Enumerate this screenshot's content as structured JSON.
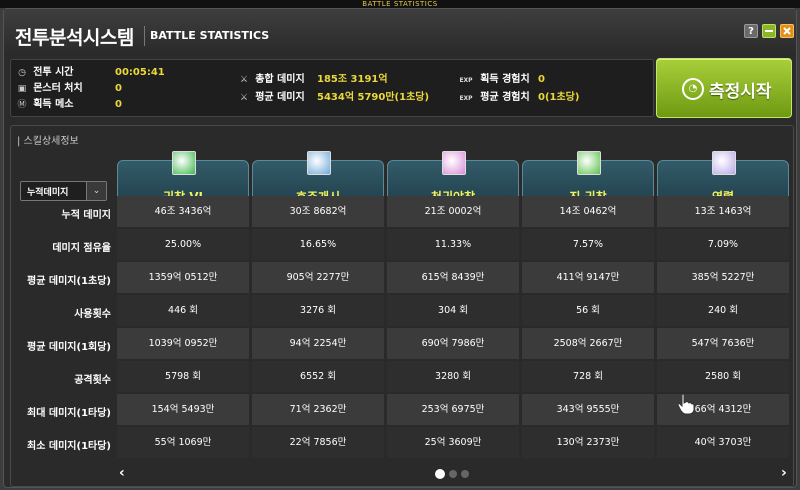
{
  "top_strip": "BATTLE STATISTICS",
  "window": {
    "title_ko": "전투분석시스템",
    "title_en": "BATTLE STATISTICS",
    "help_label": "?",
    "colors": {
      "accent_green": "#8bb52a",
      "close_orange": "#e2901a",
      "value_yellow": "#e9d93a",
      "header_teal": "#2b4f5c"
    }
  },
  "stats": {
    "battle_time": {
      "label": "전투 시간",
      "value": "00:05:41",
      "icon": "clock-icon"
    },
    "monsters": {
      "label": "몬스터 처치",
      "value": "0",
      "icon": "monster-icon"
    },
    "meso": {
      "label": "획득 메소",
      "value": "0",
      "icon": "meso-icon"
    },
    "total_damage": {
      "label": "총합 데미지",
      "value": "185조 3191억",
      "icon": "sword-icon"
    },
    "avg_damage": {
      "label": "평균 데미지",
      "value": "5434억 5790만(1초당)",
      "icon": "sword-icon"
    },
    "exp_gain": {
      "label": "획득 경험치",
      "value": "0",
      "icon_text": "EXP"
    },
    "avg_exp": {
      "label": "평균 경험치",
      "value": "0(1초당)",
      "icon_text": "EXP"
    }
  },
  "measure_button": {
    "label": "측정시작",
    "icon": "gauge-icon"
  },
  "detail": {
    "title": "| 스킬상세정보",
    "sort": {
      "selected": "누적데미지",
      "arrow": "⌄"
    },
    "row_labels": [
      "누적 데미지",
      "데미지 점유율",
      "평균 데미지(1초당)",
      "사용횟수",
      "평균 데미지(1회당)",
      "공격횟수",
      "최대 데미지(1타당)",
      "최소 데미지(1타당)"
    ],
    "skills": [
      {
        "name": "귀참 VI",
        "icon_color": "#3cb84a",
        "values": [
          "46조 3436억",
          "25.00%",
          "1359억 0512만",
          "446 회",
          "1039억 0952만",
          "5798 회",
          "154억 5493만",
          "55억 1069만"
        ]
      },
      {
        "name": "호주개시",
        "icon_color": "#6fa8d8",
        "values": [
          "30조 8682억",
          "16.65%",
          "905억 2277만",
          "3276 회",
          "94억 2254만",
          "6552 회",
          "71억 2362만",
          "22억 7856만"
        ]
      },
      {
        "name": "천귀야참",
        "icon_color": "#d98ad8",
        "values": [
          "21조 0002억",
          "11.33%",
          "615억 8439만",
          "304 회",
          "690억 7986만",
          "3280 회",
          "253억 6975만",
          "25억 3609만"
        ]
      },
      {
        "name": "진 귀참",
        "icon_color": "#5cc04a",
        "values": [
          "14조 0462억",
          "7.57%",
          "411억 9147만",
          "56 회",
          "2508억 2667만",
          "728 회",
          "343억 9555만",
          "130억 2373만"
        ]
      },
      {
        "name": "영렬",
        "icon_color": "#b8a8e8",
        "values": [
          "13조 1463억",
          "7.09%",
          "385억 5227만",
          "240 회",
          "547억 7636만",
          "2580 회",
          "66억 4312만",
          "40억 3703만"
        ]
      }
    ],
    "nav": {
      "prev": "‹",
      "next": "›",
      "pages": 3,
      "current_page": 1
    }
  }
}
